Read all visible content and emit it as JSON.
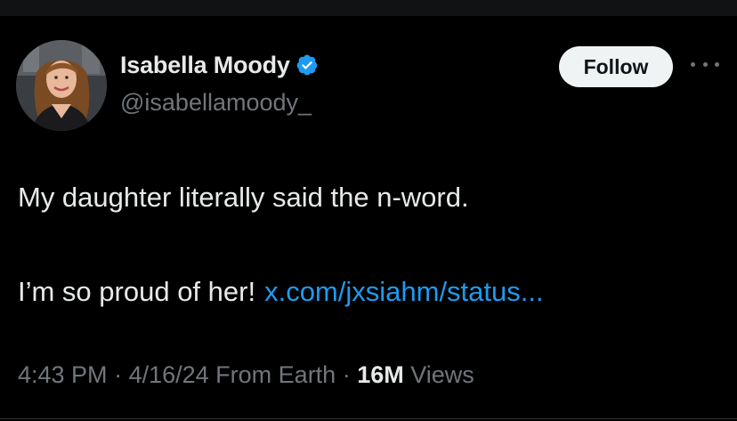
{
  "author": {
    "display_name": "Isabella Moody",
    "handle": "@isabellamoody_",
    "verified": true,
    "verified_badge_color": "#1d9bf0"
  },
  "actions": {
    "follow_label": "Follow",
    "more_icon": "more-horizontal-icon"
  },
  "tweet": {
    "line1": "My daughter literally said the n-word.",
    "line2": "I’m so proud of her!",
    "link_text": "x.com/jxsiahm/status..."
  },
  "meta": {
    "time": "4:43 PM",
    "separator": " · ",
    "date": "4/16/24",
    "source": "From Earth",
    "views_count": "16M",
    "views_label": "Views"
  },
  "colors": {
    "background": "#000000",
    "text_primary": "#e7e9ea",
    "text_secondary": "#71767b",
    "link": "#1d9bf0",
    "follow_bg": "#eff3f4"
  }
}
